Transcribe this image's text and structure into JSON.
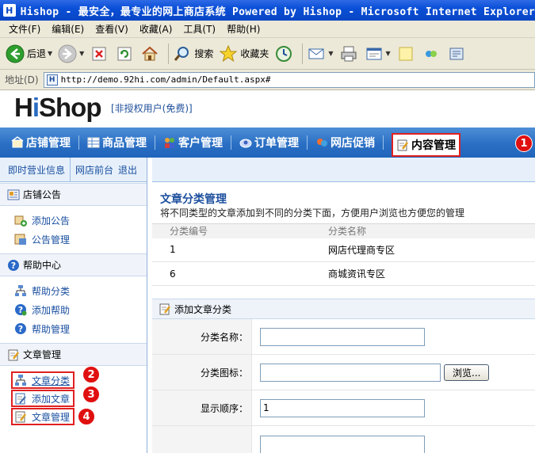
{
  "window": {
    "title": "Hishop - 最安全，最专业的网上商店系统 Powered by Hishop - Microsoft Internet Explorer"
  },
  "menubar": {
    "items": [
      "文件(F)",
      "编辑(E)",
      "查看(V)",
      "收藏(A)",
      "工具(T)",
      "帮助(H)"
    ]
  },
  "toolbar": {
    "back_label": "后退",
    "search_label": "搜索",
    "favorites_label": "收藏夹"
  },
  "address": {
    "label": "地址(D)",
    "url": "http://demo.92hi.com/admin/Default.aspx#"
  },
  "header": {
    "logo_h": "H",
    "logo_i": "i",
    "logo_rest": "Shop",
    "unauthorized_text": "[非授权用户(免费)]"
  },
  "nav": {
    "items": [
      "店铺管理",
      "商品管理",
      "客户管理",
      "订单管理",
      "网店促销",
      "内容管理"
    ],
    "active_index": 5
  },
  "badges": [
    "1",
    "2",
    "3",
    "4"
  ],
  "sidebar": {
    "top_links": [
      "即时营业信息",
      "网店前台",
      "退出"
    ],
    "sections": [
      {
        "title": "店铺公告",
        "items": [
          "添加公告",
          "公告管理"
        ]
      },
      {
        "title": "帮助中心",
        "items": [
          "帮助分类",
          "添加帮助",
          "帮助管理"
        ]
      },
      {
        "title": "文章管理",
        "items": [
          "文章分类",
          "添加文章",
          "文章管理"
        ]
      }
    ]
  },
  "main": {
    "title": "文章分类管理",
    "description": "将不同类型的文章添加到不同的分类下面，方便用户浏览也方便您的管理",
    "table": {
      "headers": [
        "分类编号",
        "分类名称"
      ],
      "rows": [
        [
          "1",
          "网店代理商专区"
        ],
        [
          "6",
          "商城资讯专区"
        ]
      ]
    },
    "form": {
      "title": "添加文章分类",
      "name_label": "分类名称：",
      "name_value": "",
      "icon_label": "分类图标：",
      "icon_value": "",
      "browse_label": "浏览...",
      "order_label": "显示顺序：",
      "order_value": "1"
    }
  },
  "colors": {
    "nav_blue": "#2a6fc4",
    "highlight_red": "#e02020",
    "link_blue": "#1a4fa0",
    "title_blue": "#1d4f9e"
  }
}
